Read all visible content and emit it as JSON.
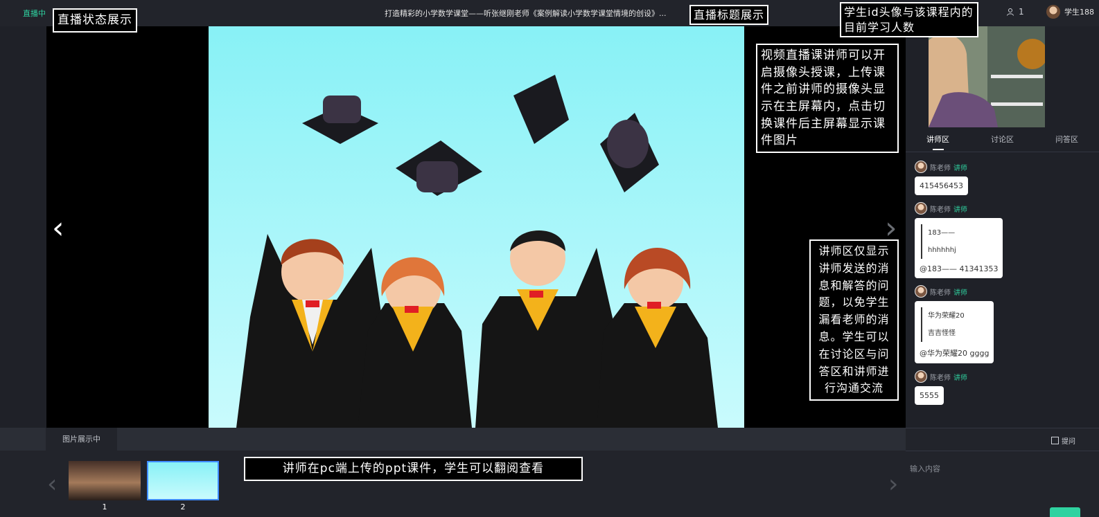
{
  "topbar": {
    "live_status": "直播中",
    "title": "打造精彩的小学数学课堂——听张继刚老师《案例解读小学数学课堂情境的创设》...",
    "online_count": "1",
    "user_name": "学生188"
  },
  "annotations": {
    "live_status": "直播状态展示",
    "title": "直播标题展示",
    "student": "学生id头像与该课程内的目前学习人数",
    "camera": "视频直播课讲师可以开启摄像头授课，上传课件之前讲师的摄像头显示在主屏幕内，点击切换课件后主屏幕显示课件图片",
    "lecturer_area": "讲师区仅显示讲师发送的消息和解答的问题，以免学生漏看老师的消息。学生可以在讨论区与问答区和讲师进行沟通交流",
    "ppt": "讲师在pc端上传的ppt课件，学生可以翻阅查看"
  },
  "panel": {
    "tabs": [
      "讲师区",
      "讨论区",
      "问答区"
    ],
    "messages": [
      {
        "author": "陈老师",
        "role": "讲师",
        "text": "415456453"
      },
      {
        "author": "陈老师",
        "role": "讲师",
        "quote1": "183——",
        "quote2": "hhhhhhj",
        "text": "@183—— 41341353"
      },
      {
        "author": "陈老师",
        "role": "讲师",
        "quote1": "华为荣耀20",
        "quote2": "吉吉怪怪",
        "text": "@华为荣耀20 gggg"
      },
      {
        "author": "陈老师",
        "role": "讲师",
        "text": "5555"
      }
    ]
  },
  "bottom": {
    "tab": "图片展示中",
    "thumbs": [
      "1",
      "2"
    ]
  },
  "input": {
    "ask_label": "提问",
    "placeholder": "输入内容"
  },
  "icons": {
    "prev": "chevron-left-icon",
    "next": "chevron-right-icon",
    "online": "person-icon"
  },
  "colors": {
    "accent": "#2fd2a0",
    "background": "#1f2128",
    "slide": "#88f1f6",
    "thumb_selected": "#3f8cff"
  }
}
